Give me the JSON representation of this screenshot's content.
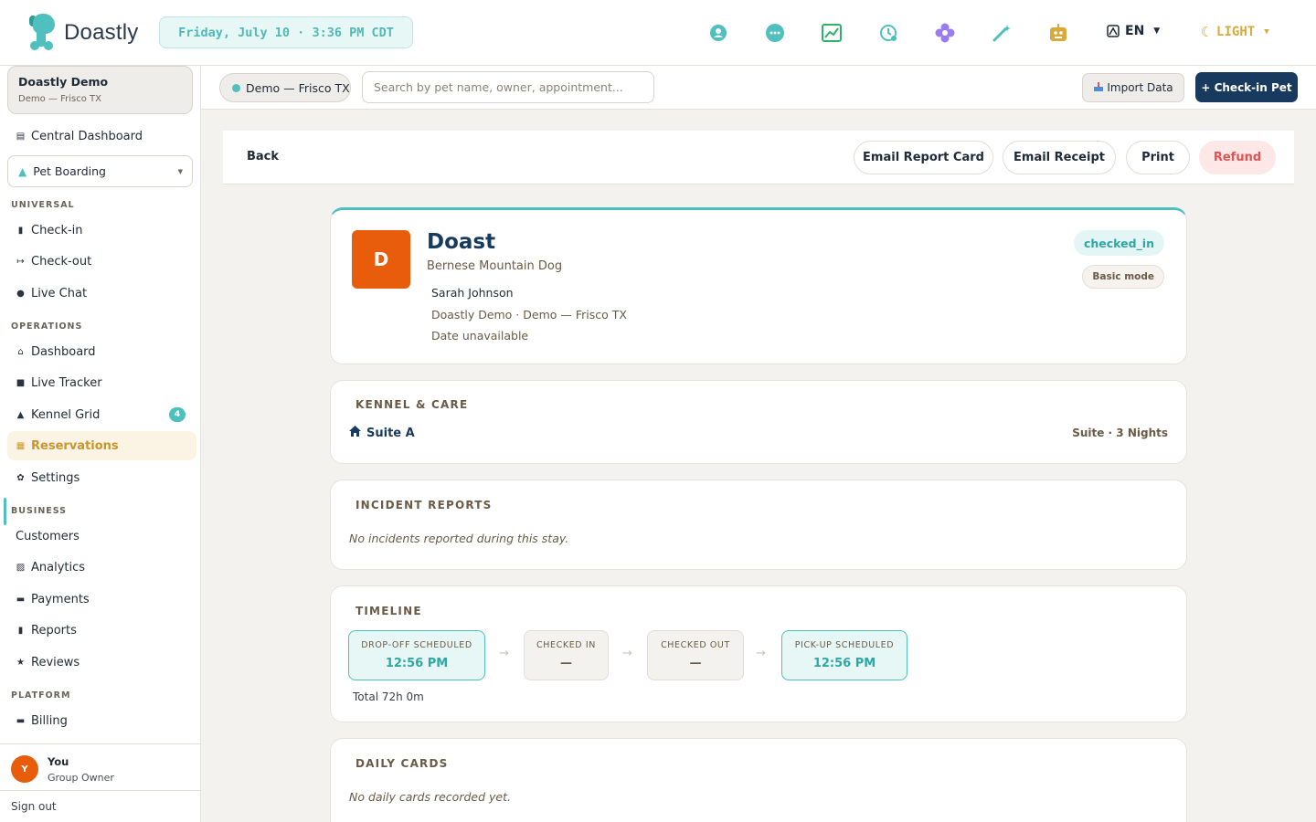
{
  "app": {
    "brand": "Doastly",
    "datetime": "Friday, July 10 · 3:36 PM CDT"
  },
  "topbar": {
    "language": "EN",
    "theme": "LIGHT",
    "colors": {
      "accent": "#4fc0bd",
      "primary": "#173a5e",
      "theme": "#d9a93c"
    }
  },
  "sidebar": {
    "org_name": "Doastly Demo",
    "org_sub": "Demo — Frisco TX",
    "central_dashboard": "Central Dashboard",
    "service": "Pet Boarding",
    "sections": {
      "universal": "UNIVERSAL",
      "operations": "OPERATIONS",
      "business": "BUSINESS",
      "platform": "PLATFORM"
    },
    "universal": [
      "Check-in",
      "Check-out",
      "Live Chat"
    ],
    "operations": [
      "Dashboard",
      "Live Tracker",
      "Kennel Grid",
      "Reservations",
      "Settings"
    ],
    "kennel_badge": "4",
    "business": [
      "Customers",
      "Analytics",
      "Payments",
      "Reports",
      "Reviews"
    ],
    "platform": [
      "Billing"
    ],
    "user": {
      "initial": "Y",
      "name": "You",
      "role": "Group Owner"
    },
    "sign_out": "Sign out"
  },
  "subheader": {
    "location": "Demo — Frisco TX",
    "search_placeholder": "Search by pet name, owner, appointment...",
    "import": "Import Data",
    "checkin": "+ Check-in Pet"
  },
  "actions": {
    "back": "Back",
    "email_report": "Email Report Card",
    "email_receipt": "Email Receipt",
    "print": "Print",
    "refund": "Refund"
  },
  "pet": {
    "initial": "D",
    "name": "Doast",
    "breed": "Bernese Mountain Dog",
    "owner": "Sarah Johnson",
    "location": "Doastly Demo · Demo — Frisco TX",
    "date": "Date unavailable",
    "status": "checked_in",
    "mode": "Basic mode"
  },
  "kennel": {
    "title": "KENNEL & CARE",
    "suite": "Suite A",
    "meta": "Suite · 3 Nights"
  },
  "incidents": {
    "title": "INCIDENT REPORTS",
    "empty": "No incidents reported during this stay."
  },
  "timeline": {
    "title": "TIMELINE",
    "steps": [
      {
        "label": "DROP-OFF SCHEDULED",
        "value": "12:56 PM"
      },
      {
        "label": "CHECKED IN",
        "value": "—"
      },
      {
        "label": "CHECKED OUT",
        "value": "—"
      },
      {
        "label": "PICK-UP SCHEDULED",
        "value": "12:56 PM"
      }
    ],
    "total": "Total 72h 0m"
  },
  "daily": {
    "title": "DAILY CARDS",
    "empty": "No daily cards recorded yet."
  }
}
